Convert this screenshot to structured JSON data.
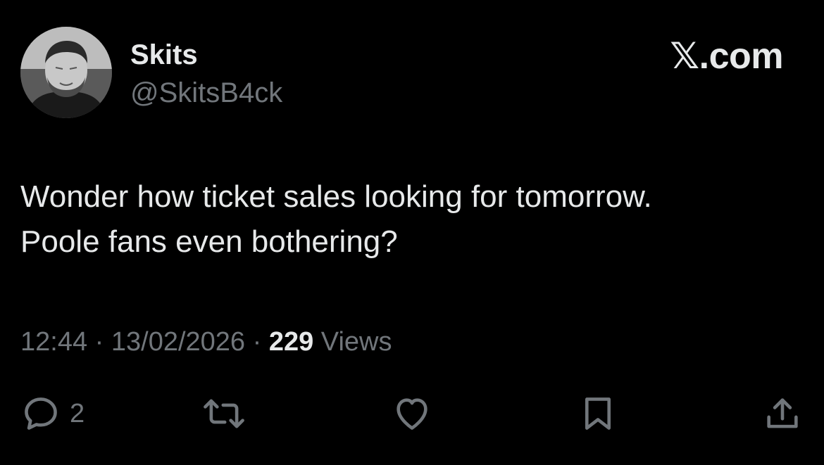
{
  "author": {
    "display_name": "Skits",
    "handle": "@SkitsB4ck",
    "avatar_icon": "profile-photo"
  },
  "brand": {
    "label": "𝕏.com"
  },
  "tweet": {
    "text": "Wonder how ticket sales looking for tomorrow.\nPoole fans even bothering?",
    "time": "12:44",
    "separator": " · ",
    "date": "13/02/2026",
    "views_count": "229",
    "views_label": " Views"
  },
  "actions": {
    "reply": {
      "icon": "reply-icon",
      "count": "2"
    },
    "repost": {
      "icon": "repost-icon"
    },
    "like": {
      "icon": "heart-icon"
    },
    "bookmark": {
      "icon": "bookmark-icon"
    },
    "share": {
      "icon": "share-icon"
    }
  },
  "colors": {
    "background": "#000000",
    "primary_text": "#e7e9ea",
    "secondary_text": "#71767b"
  }
}
